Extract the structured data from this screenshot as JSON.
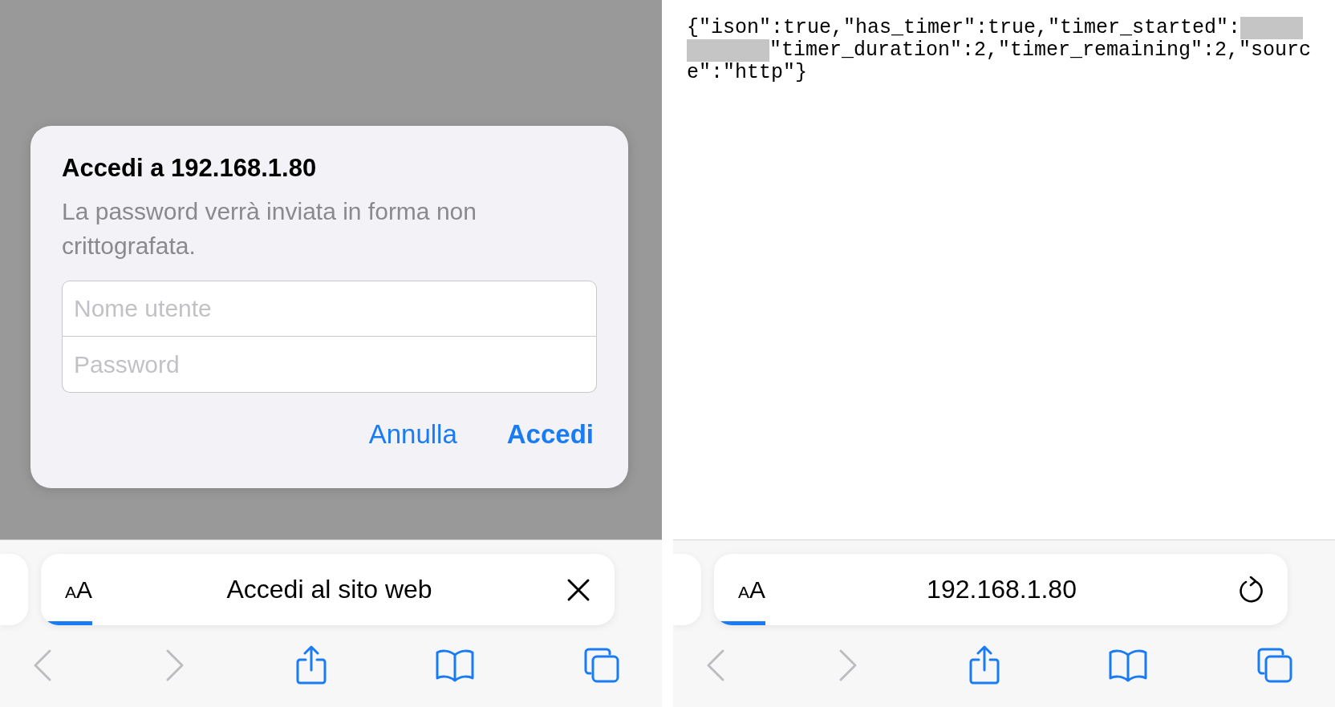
{
  "screens": [
    {
      "kind": "dialog",
      "dialog": {
        "title": "Accedi a 192.168.1.80",
        "message": "La password verrà inviata in forma non crittografata.",
        "fields": [
          {
            "placeholder": "Nome utente"
          },
          {
            "placeholder": "Password"
          }
        ],
        "buttons": [
          {
            "label": "Annulla",
            "primary": false
          },
          {
            "label": "Accedi",
            "primary": true
          }
        ]
      },
      "address_bar": {
        "text_size_small": "A",
        "text_size_large": "A",
        "text": "Accedi al sito web",
        "close_button": true,
        "level": 0.09
      },
      "toolbar": [
        {
          "kind": "back",
          "disabled": true
        },
        {
          "kind": "forward",
          "disabled": true
        },
        {
          "kind": "share",
          "disabled": false
        },
        {
          "kind": "bookmarks",
          "disabled": false
        },
        {
          "kind": "tabs",
          "disabled": false
        }
      ]
    },
    {
      "kind": "text",
      "lines": [
        {
          "text": "{\"ison\":true,\"has_timer\":true,\"timer_started\":",
          "redacted_after": true
        },
        {
          "text": "\"timer_duration\":2,\"timer_remaining\":2,\"sourc",
          "redacted_before": true
        },
        {
          "text": "e\":\"http\"}"
        }
      ],
      "address_bar": {
        "text_size_small": "A",
        "text_size_large": "A",
        "text": "192.168.1.80",
        "reload_button": true,
        "level": 0.09
      },
      "toolbar": [
        {
          "kind": "back",
          "disabled": true
        },
        {
          "kind": "forward",
          "disabled": true
        },
        {
          "kind": "share",
          "disabled": false
        },
        {
          "kind": "bookmarks",
          "disabled": false
        },
        {
          "kind": "tabs",
          "disabled": false
        }
      ]
    }
  ]
}
